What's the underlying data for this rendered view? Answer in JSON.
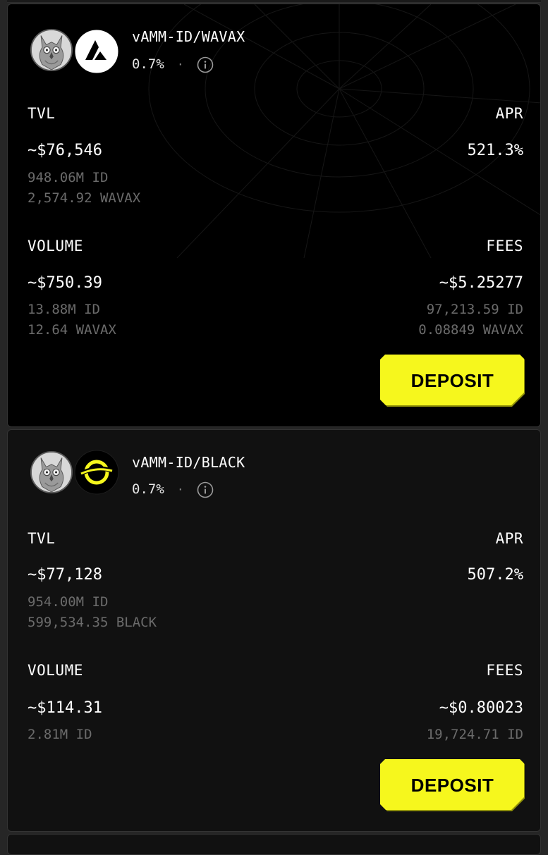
{
  "pools": [
    {
      "pair": "vAMM-ID/WAVAX",
      "fee": "0.7%",
      "separator": "·",
      "token_icons": [
        "owl-token-icon",
        "avalanche-icon"
      ],
      "tvl": {
        "label": "TVL",
        "value": "~$76,546",
        "sub": [
          "948.06M ID",
          "2,574.92 WAVAX"
        ]
      },
      "apr": {
        "label": "APR",
        "value": "521.3%"
      },
      "volume": {
        "label": "VOLUME",
        "value": "~$750.39",
        "sub": [
          "13.88M ID",
          "12.64 WAVAX"
        ]
      },
      "fees": {
        "label": "FEES",
        "value": "~$5.25277",
        "sub": [
          "97,213.59 ID",
          "0.08849 WAVAX"
        ]
      },
      "button": "DEPOSIT"
    },
    {
      "pair": "vAMM-ID/BLACK",
      "fee": "0.7%",
      "separator": "·",
      "token_icons": [
        "owl-token-icon",
        "black-token-icon"
      ],
      "tvl": {
        "label": "TVL",
        "value": "~$77,128",
        "sub": [
          "954.00M ID",
          "599,534.35 BLACK"
        ]
      },
      "apr": {
        "label": "APR",
        "value": "507.2%"
      },
      "volume": {
        "label": "VOLUME",
        "value": "~$114.31",
        "sub": [
          "2.81M ID"
        ]
      },
      "fees": {
        "label": "FEES",
        "value": "~$0.80023",
        "sub": [
          "19,724.71 ID"
        ]
      },
      "button": "DEPOSIT"
    }
  ],
  "colors": {
    "accent": "#f6f71d",
    "card_bg_primary": "#000000",
    "card_bg_secondary": "#111111",
    "muted_text": "#6b6b6b"
  }
}
